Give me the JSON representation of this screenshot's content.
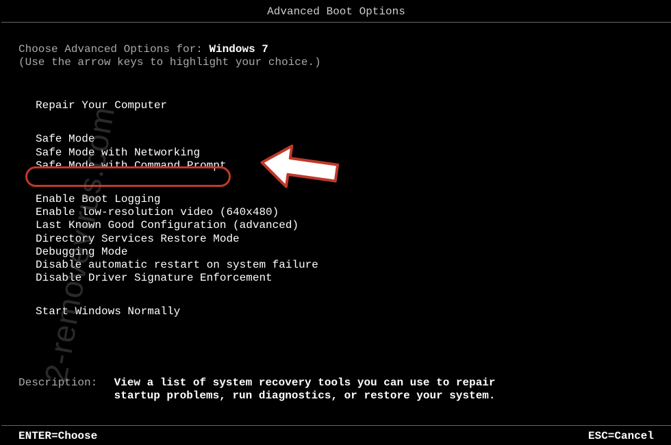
{
  "title": "Advanced Boot Options",
  "intro": {
    "prefix": "Choose Advanced Options for: ",
    "os_name": "Windows 7",
    "hint": "(Use the arrow keys to highlight your choice.)"
  },
  "menu": {
    "repair": "Repair Your Computer",
    "safe_modes": [
      "Safe Mode",
      "Safe Mode with Networking",
      "Safe Mode with Command Prompt"
    ],
    "options": [
      "Enable Boot Logging",
      "Enable low-resolution video (640x480)",
      "Last Known Good Configuration (advanced)",
      "Directory Services Restore Mode",
      "Debugging Mode",
      "Disable automatic restart on system failure",
      "Disable Driver Signature Enforcement"
    ],
    "normal": "Start Windows Normally"
  },
  "description": {
    "label": "Description:",
    "text": "View a list of system recovery tools you can use to repair startup problems, run diagnostics, or restore your system."
  },
  "footer": {
    "left": "ENTER=Choose",
    "right": "ESC=Cancel"
  },
  "watermark": "2-removevirus.com"
}
